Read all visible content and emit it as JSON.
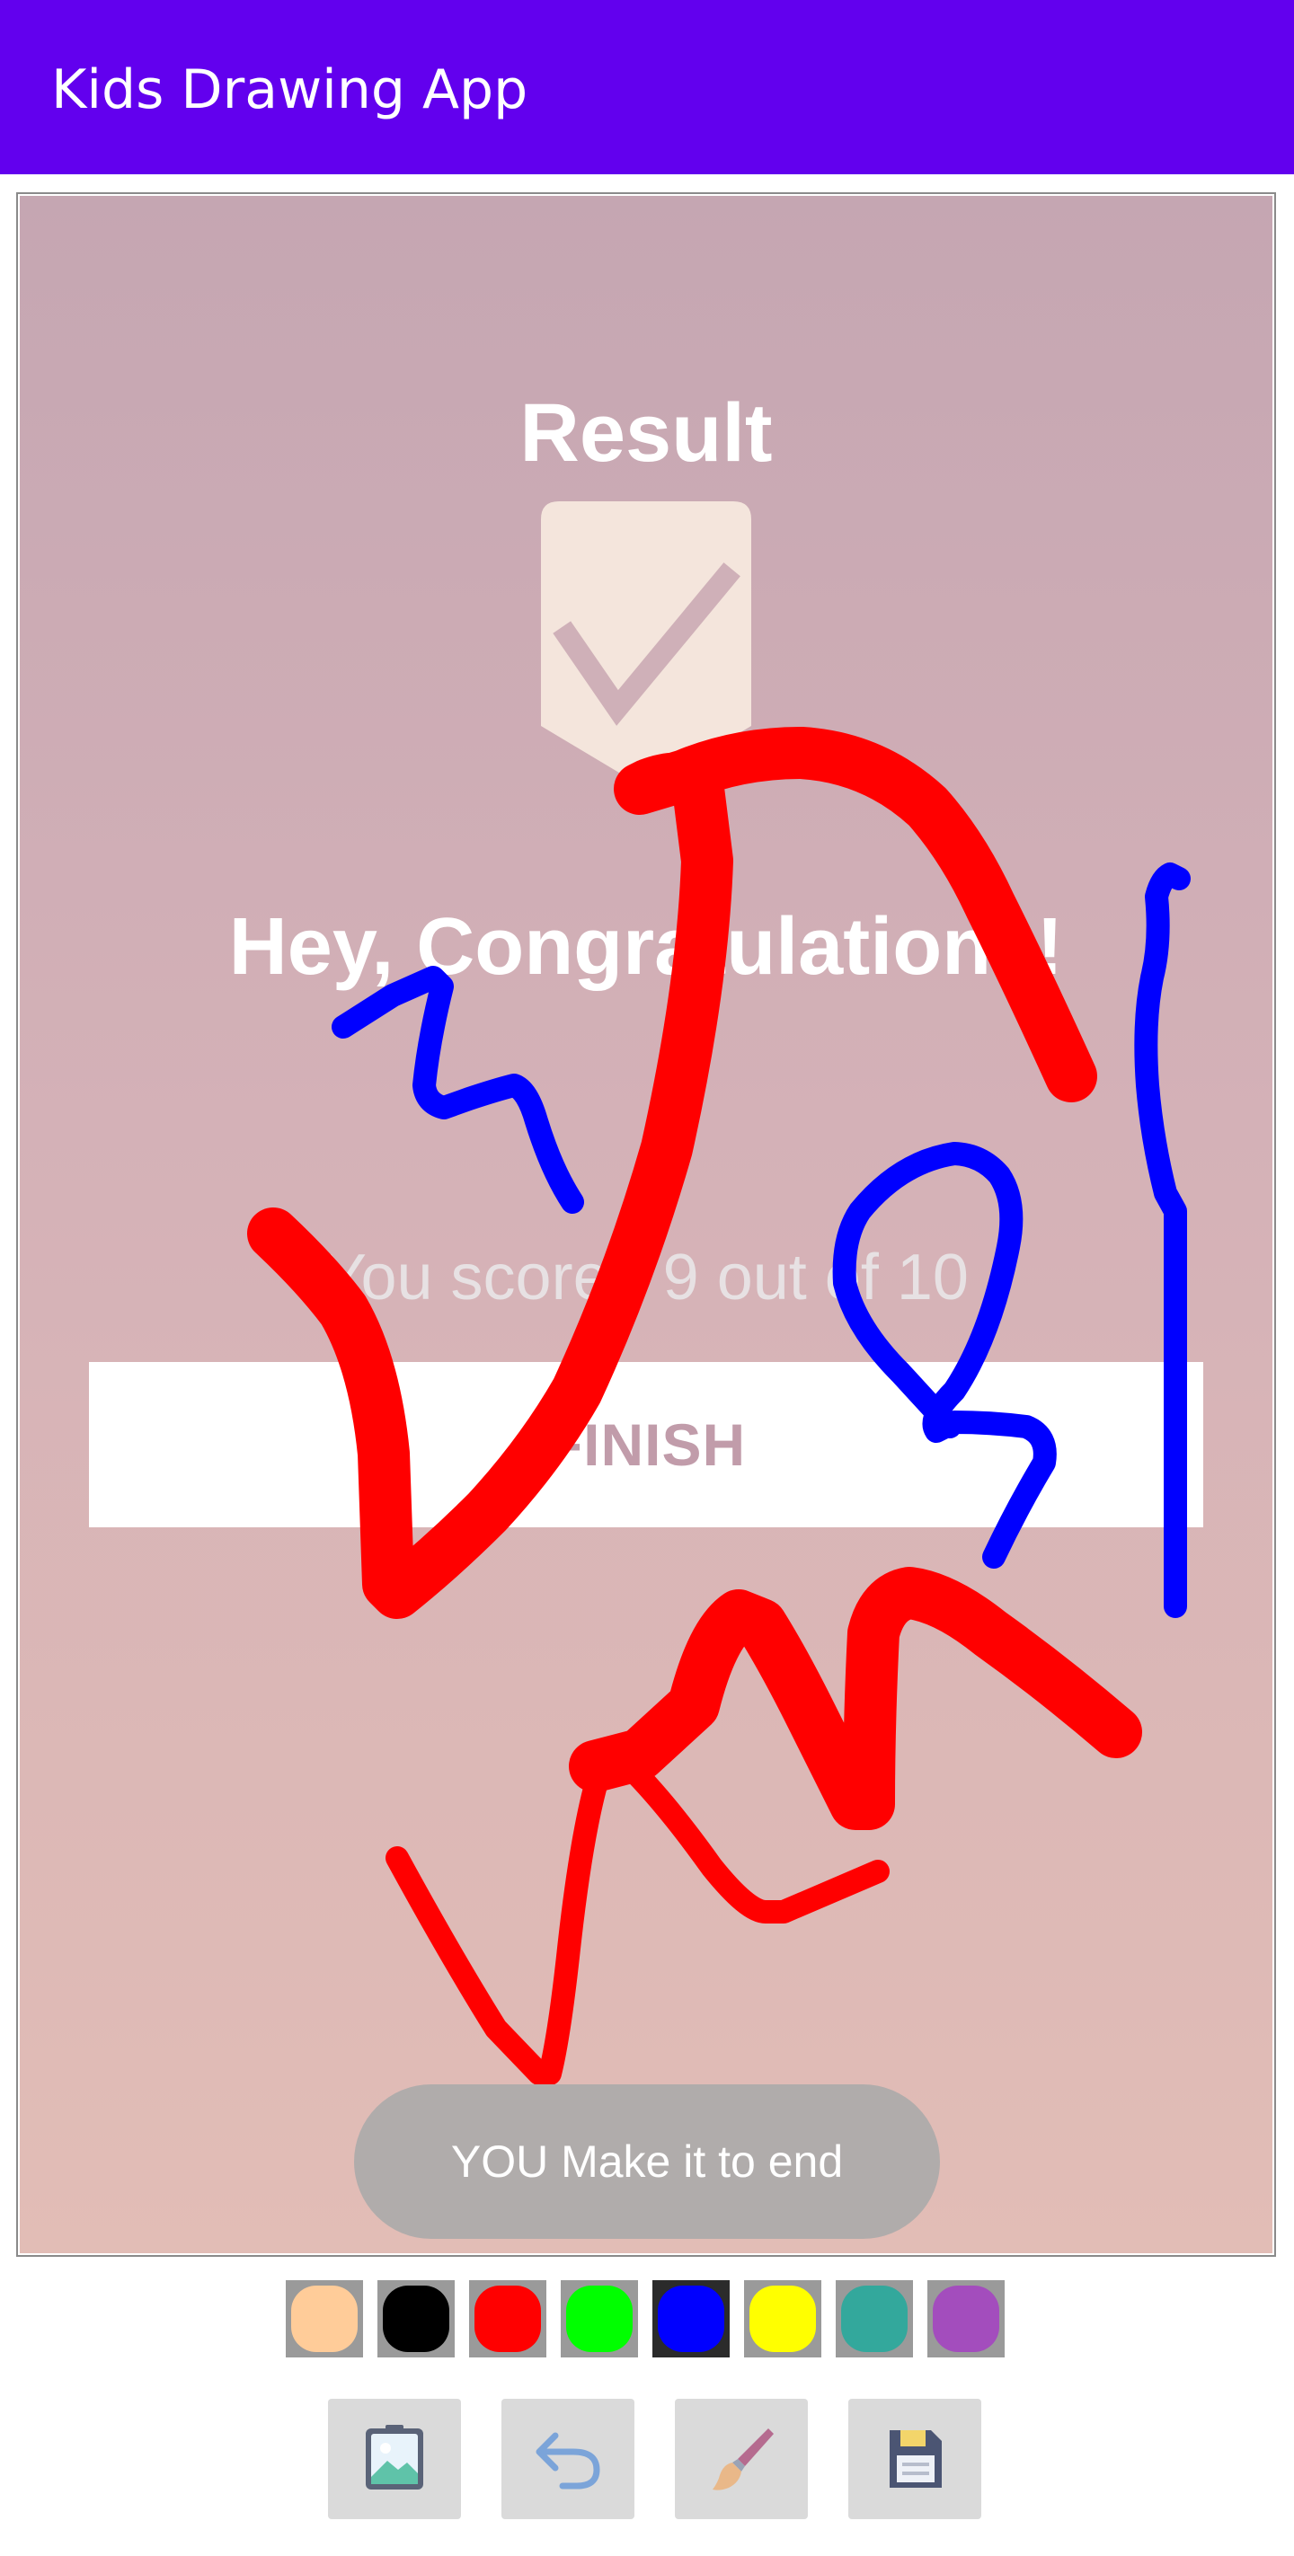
{
  "app_bar": {
    "title": "Kids Drawing App"
  },
  "background_image": {
    "title": "Result",
    "congrats_text": "Hey, Congratulations!",
    "score_text": "You scored 9 out of 10",
    "finish_label": "FINISH"
  },
  "toast": {
    "message": "YOU Make it to end"
  },
  "palette": {
    "colors": [
      {
        "name": "skin",
        "hex": "#ffcc99"
      },
      {
        "name": "black",
        "hex": "#000000"
      },
      {
        "name": "red",
        "hex": "#ff0000"
      },
      {
        "name": "green",
        "hex": "#00ff00"
      },
      {
        "name": "blue",
        "hex": "#0000ff"
      },
      {
        "name": "yellow",
        "hex": "#ffff00"
      },
      {
        "name": "teal",
        "hex": "#33a89c"
      },
      {
        "name": "purple",
        "hex": "#a34dbd"
      }
    ],
    "selected": "blue"
  },
  "tools": [
    {
      "name": "gallery-icon"
    },
    {
      "name": "undo-icon"
    },
    {
      "name": "brush-icon"
    },
    {
      "name": "save-icon"
    }
  ],
  "colors": {
    "app_bar": "#6200ee",
    "stroke_red": "#ff0000",
    "stroke_blue": "#0000ff"
  }
}
